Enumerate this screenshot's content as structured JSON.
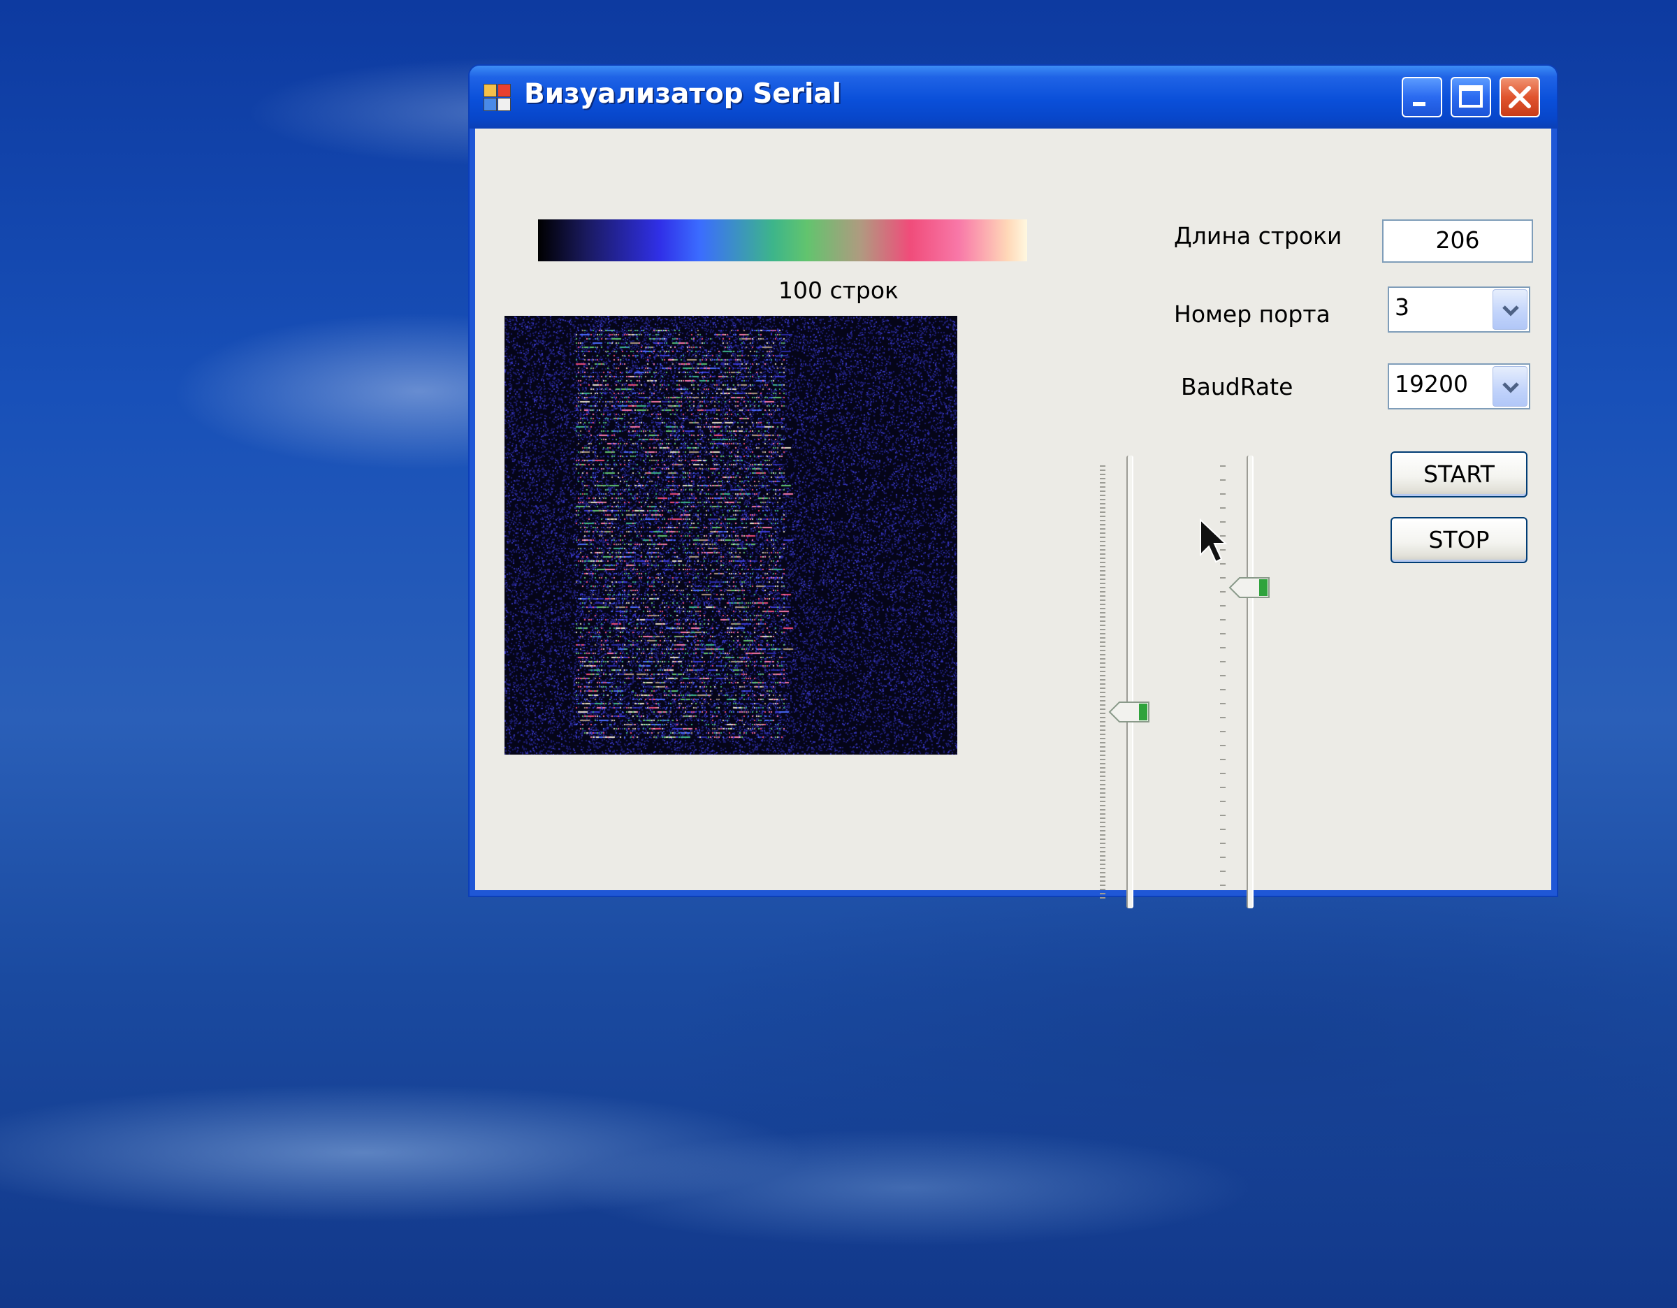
{
  "window": {
    "title": "Визуализатор Serial",
    "title_buttons": [
      "minimize",
      "maximize",
      "close"
    ]
  },
  "visualizer": {
    "rows_label": "100 строк",
    "colorbar_colors": [
      "#000000",
      "#3030e8",
      "#3db58a",
      "#f04c7a",
      "#fff8e0"
    ]
  },
  "settings": {
    "line_length_label": "Длина строки",
    "line_length_value": "206",
    "port_label": "Номер порта",
    "port_value": "3",
    "baud_label": "BaudRate",
    "baud_value": "19200"
  },
  "buttons": {
    "start": "START",
    "stop": "STOP"
  },
  "sliders": {
    "left_level": 0.57,
    "right_level": 0.28
  },
  "colors": {
    "titlebar": "#0a4fd9",
    "client": "#ecebe6",
    "close_button": "#e0542e"
  }
}
